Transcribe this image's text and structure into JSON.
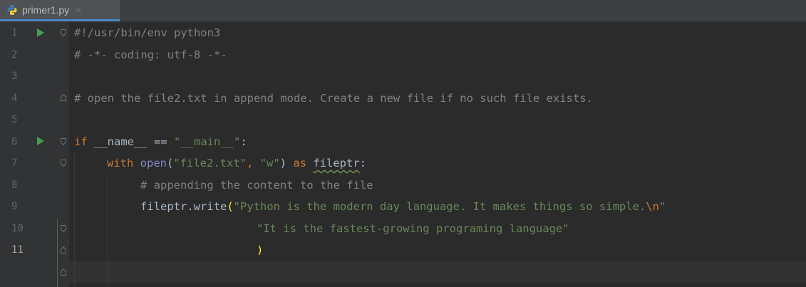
{
  "tab": {
    "filename": "primer1.py",
    "close": "×"
  },
  "current_line": 11,
  "line_numbers": [
    "1",
    "2",
    "3",
    "4",
    "5",
    "6",
    "7",
    "8",
    "9",
    "10",
    "11"
  ],
  "code": {
    "l1": "#!/usr/bin/env python3",
    "l2": "# -*- coding: utf-8 -*-",
    "l3": "",
    "l4": "# open the file2.txt in append mode. Create a new file if no such file exists.",
    "l5": "",
    "l6_kw": "if",
    "l6_name1": " __name__ == ",
    "l6_str": "\"__main__\"",
    "l6_end": ":",
    "l7_kw": "with",
    "l7_open": "open",
    "l7_p1": "(",
    "l7_str1": "\"file2.txt\"",
    "l7_comma": ", ",
    "l7_str2": "\"w\"",
    "l7_p2": ")",
    "l7_as": " as ",
    "l7_var": "fileptr",
    "l7_end": ":",
    "l8": "# appending the content to the file",
    "l9_call": "fileptr.write",
    "l9_paren": "(",
    "l9_str": "\"Python is the modern day language. It makes things so simple.",
    "l9_esc": "\\n",
    "l9_strend": "\"",
    "l10_str": "\"It is the fastest-growing programing language\"",
    "l11_paren": ")"
  },
  "colors": {
    "keyword": "#cc7832",
    "string": "#6a8759",
    "comment": "#808080",
    "builtin": "#8888c6",
    "run_marker": "#499c54",
    "tab_underline": "#4a88c7"
  }
}
